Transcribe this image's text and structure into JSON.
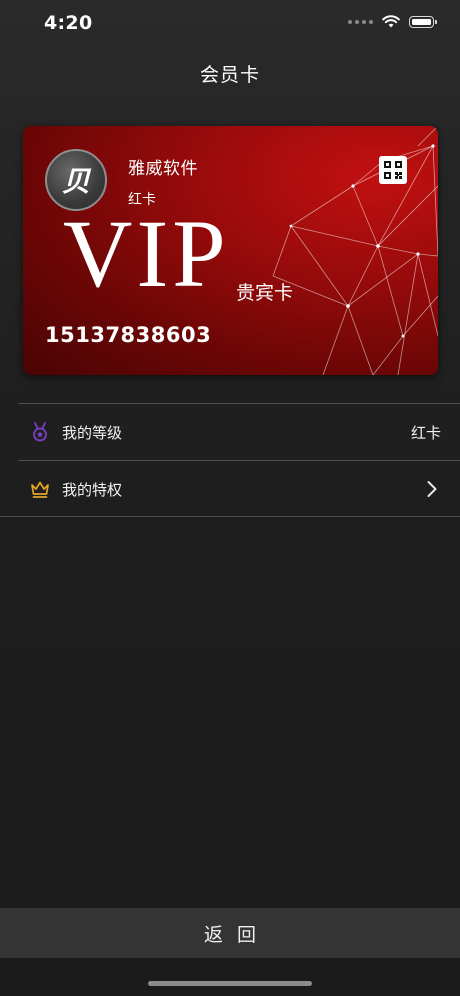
{
  "status_bar": {
    "time": "4:20",
    "icons": [
      "signal-icon",
      "wifi-icon",
      "battery-icon"
    ]
  },
  "nav": {
    "title": "会员卡"
  },
  "card": {
    "logo_glyph": "贝",
    "company": "雅威软件",
    "level": "红卡",
    "vip_text": "VIP",
    "vip_subtitle": "贵宾卡",
    "number": "15137838603",
    "qr_icon": "qr-code-icon",
    "colors": {
      "primary": "#9a0b0b",
      "highlight": "#c21010"
    }
  },
  "menu": {
    "items": [
      {
        "icon": "medal-icon",
        "label": "我的等级",
        "value": "红卡",
        "icon_color": "#7b3fc4"
      },
      {
        "icon": "crown-icon",
        "label": "我的特权",
        "value": "",
        "icon_color": "#e3a52a"
      }
    ]
  },
  "footer": {
    "return_label": "返回"
  }
}
